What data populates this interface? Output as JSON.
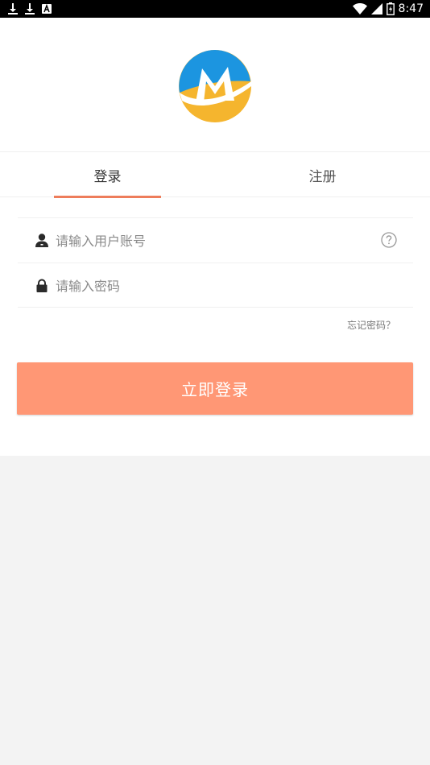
{
  "status_bar": {
    "time": "8:47",
    "left_icons": [
      "download-icon",
      "download-icon",
      "a-icon"
    ],
    "right_icons": [
      "wifi-icon",
      "signal-icon",
      "battery-icon"
    ]
  },
  "logo": {
    "letter": "M",
    "colors": {
      "blue": "#1c95e0",
      "yellow": "#f5b52e"
    }
  },
  "tabs": [
    {
      "label": "登录",
      "active": true
    },
    {
      "label": "注册",
      "active": false
    }
  ],
  "form": {
    "username": {
      "placeholder": "请输入用户账号",
      "value": ""
    },
    "password": {
      "placeholder": "请输入密码",
      "value": ""
    },
    "forgot_label": "忘记密码？",
    "submit_label": "立即登录"
  },
  "colors": {
    "accent": "#ee7d5b",
    "button": "#ff9775",
    "background": "#f3f3f3"
  }
}
